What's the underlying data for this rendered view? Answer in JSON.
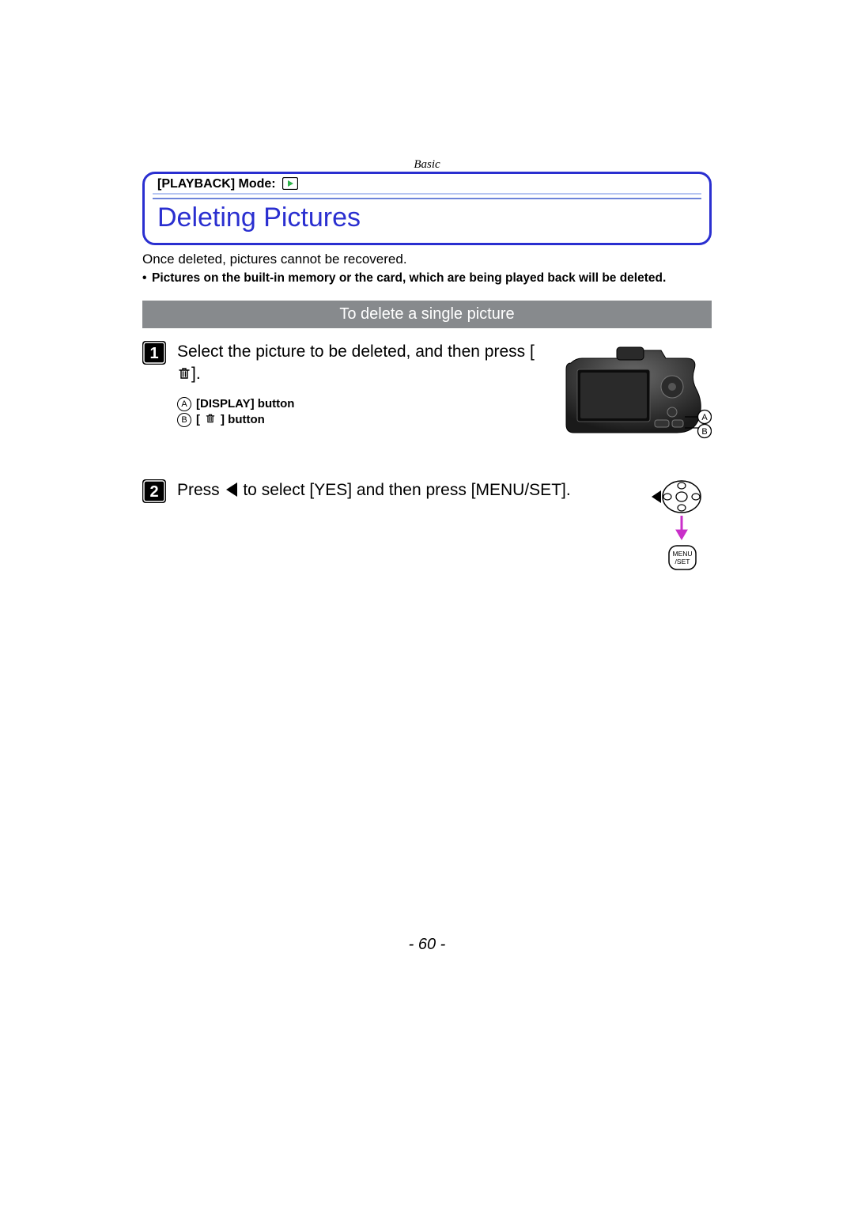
{
  "breadcrumb": "Basic",
  "mode_label": "[PLAYBACK] Mode:",
  "play_icon_name": "playback-icon",
  "title": "Deleting Pictures",
  "warning_line1": "Once deleted, pictures cannot be recovered.",
  "warning_line2": "Pictures on the built-in memory or the card, which are being played back will be deleted.",
  "section_heading": "To delete a single picture",
  "step1": {
    "text_part1": "Select the picture to be deleted, and then press [",
    "text_part2": "].",
    "legend": {
      "A": "[DISPLAY] button",
      "B_pre": "[",
      "B_post": "] button"
    },
    "callouts": {
      "A": "A",
      "B": "B"
    }
  },
  "step2": {
    "text_part1": "Press ",
    "text_part2": " to select [YES] and then press [MENU/SET].",
    "menuset_label": "MENU\n/SET"
  },
  "page_number": "- 60 -"
}
